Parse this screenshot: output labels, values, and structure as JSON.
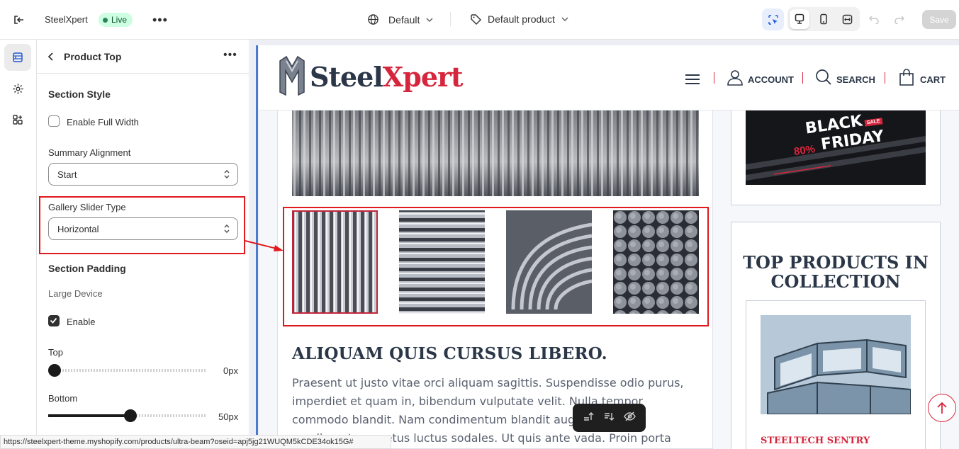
{
  "topbar": {
    "store_name": "SteelXpert",
    "live_label": "Live",
    "theme_selector": "Default",
    "template_selector": "Default product",
    "save_label": "Save"
  },
  "panel": {
    "title": "Product Top",
    "section_style": "Section Style",
    "enable_full_width": "Enable Full Width",
    "summary_alignment": {
      "label": "Summary Alignment",
      "value": "Start"
    },
    "gallery_slider_type": {
      "label": "Gallery Slider Type",
      "value": "Horizontal"
    },
    "section_padding": "Section Padding",
    "large_device": "Large Device",
    "enable": "Enable",
    "top": {
      "label": "Top",
      "value": "0px",
      "level": 0
    },
    "bottom": {
      "label": "Bottom",
      "value": "50px",
      "level": 0.5
    }
  },
  "status_url": "https://steelxpert-theme.myshopify.com/products/ultra-beam?oseid=apj5jg21WUQM5kCDE34ok15G#",
  "site": {
    "logo_steel": "Steel",
    "logo_xpert": "Xpert",
    "nav": {
      "account": "ACCOUNT",
      "search": "SEARCH",
      "cart": "CART"
    },
    "product_title": "ALIQUAM QUIS CURSUS LIBERO.",
    "product_description": "Praesent ut justo vitae orci aliquam sagittis. Suspendisse odio purus, imperdiet et quam in, bibendum vulputate velit. Nulla tempor commodo blandit. Nam condimentum blandit augue, non condimentum metus luctus sodales. Ut quis ante vada. Proin porta eget velit at pulvinar. Integer commodo",
    "banner": {
      "line1": "BLACK",
      "line2": "FRIDAY",
      "sale": "SALE",
      "percent": "80%"
    },
    "top_products_title": "TOP PRODUCTS IN COLLECTION",
    "product_name": "STEELTECH SENTRY"
  },
  "colors": {
    "brand_navy": "#2b3748",
    "brand_red": "#d6263d",
    "annotation_red": "#e0191f",
    "live_badge_bg": "#cdfee1"
  }
}
